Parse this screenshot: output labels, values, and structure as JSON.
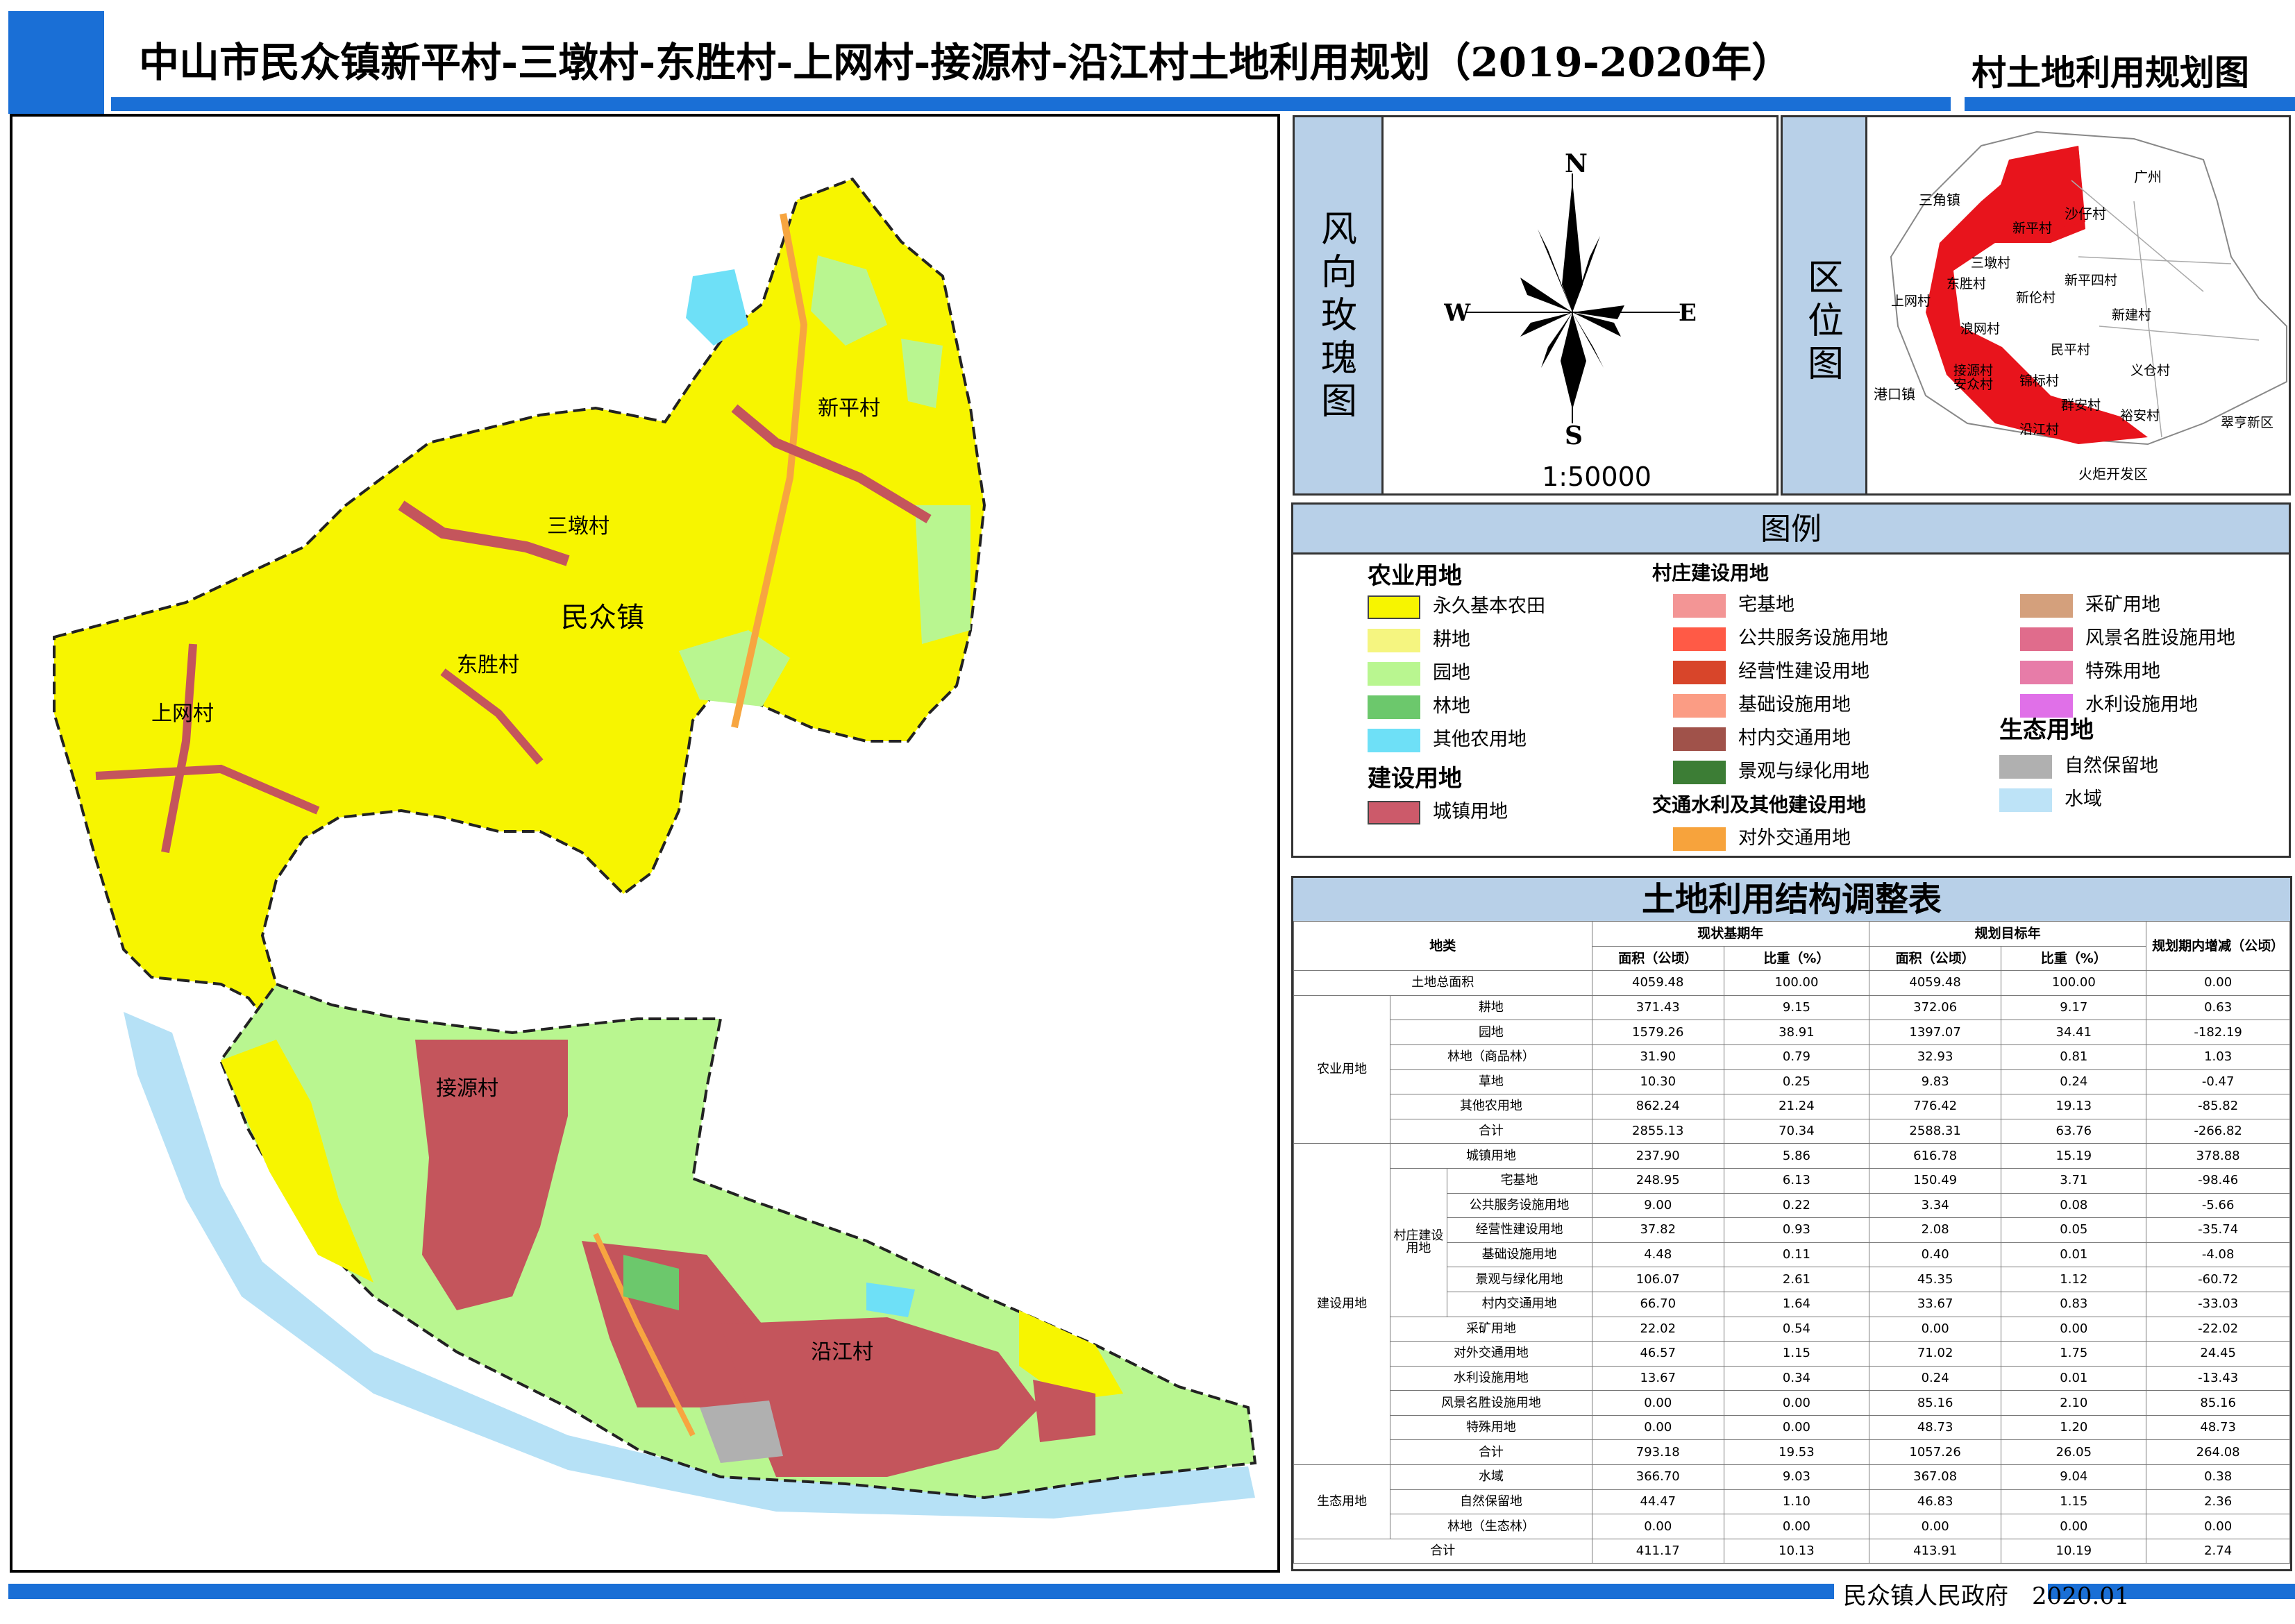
{
  "header": {
    "title": "中山市民众镇新平村-三墩村-东胜村-上网村-接源村-沿江村土地利用规划（2019-2020年）",
    "subtitle": "村土地利用规划图"
  },
  "footer": {
    "text": "民众镇人民政府　2020.01"
  },
  "map": {
    "labels": {
      "town": "民众镇",
      "xinping": "新平村",
      "sandun": "三墩村",
      "dongsheng": "东胜村",
      "shangwang": "上网村",
      "jieyuan": "接源村",
      "yanjiang": "沿江村"
    },
    "colors": {
      "permanent_farmland": "#f7f500",
      "garden": "#b9f690",
      "urban": "#c4555c",
      "forest": "#6cc86c",
      "other_agri": "#6ee0f7",
      "water": "#b6e1f6",
      "road": "#f7a540",
      "nature": "#b0b0b0",
      "scenic": "#e06c8c"
    }
  },
  "wind_rose": {
    "label": "风向玫瑰图",
    "north": "N",
    "south": "S",
    "east": "E",
    "west": "W",
    "scale": "1:50000"
  },
  "location": {
    "label": "区位图",
    "places": {
      "guangzhou": "广州",
      "sanjiao": "三角镇",
      "shazai": "沙仔村",
      "xinping": "新平村",
      "sandun": "三墩村",
      "dongsheng": "东胜村",
      "shangwang": "上网村",
      "xinping4": "新平四村",
      "xinlun": "新伦村",
      "xinjian": "新建村",
      "langwang": "浪网村",
      "minping": "民平村",
      "jieyuan": "接源村",
      "jinbiao": "锦标村",
      "yicang": "义仓村",
      "gangkou": "港口镇",
      "anzhong": "安众村",
      "qun_an": "群安村",
      "yu_an": "裕安村",
      "yanjiang": "沿江村",
      "cuiheng": "翠亨新区",
      "huoju": "火炬开发区"
    }
  },
  "legend": {
    "title": "图例",
    "groups": {
      "agri": "农业用地",
      "build": "建设用地",
      "village": "村庄建设用地",
      "transport": "交通水利及其他建设用地",
      "eco": "生态用地"
    },
    "items": [
      {
        "label": "永久基本农田",
        "color": "#f7f500",
        "border": true
      },
      {
        "label": "耕地",
        "color": "#f5f580",
        "border": false
      },
      {
        "label": "园地",
        "color": "#b9f690",
        "border": false
      },
      {
        "label": "林地",
        "color": "#6cc86c",
        "border": false
      },
      {
        "label": "其他农用地",
        "color": "#6ee0f7",
        "border": false
      },
      {
        "label": "城镇用地",
        "color": "#cc5a6a",
        "border": true
      },
      {
        "label": "宅基地",
        "color": "#f39595",
        "border": false
      },
      {
        "label": "公共服务设施用地",
        "color": "#ff5a46",
        "border": false
      },
      {
        "label": "经营性建设用地",
        "color": "#d8452a",
        "border": false
      },
      {
        "label": "基础设施用地",
        "color": "#fb9c84",
        "border": false
      },
      {
        "label": "村内交通用地",
        "color": "#a0524a",
        "border": false
      },
      {
        "label": "景观与绿化用地",
        "color": "#3c7d35",
        "border": false
      },
      {
        "label": "对外交通用地",
        "color": "#f7a33c",
        "border": false
      },
      {
        "label": "采矿用地",
        "color": "#d4a07c",
        "border": false
      },
      {
        "label": "风景名胜设施用地",
        "color": "#e06c8c",
        "border": false
      },
      {
        "label": "特殊用地",
        "color": "#e77ca8",
        "border": false
      },
      {
        "label": "水利设施用地",
        "color": "#e070e8",
        "border": false
      },
      {
        "label": "自然保留地",
        "color": "#b0b0b0",
        "border": false
      },
      {
        "label": "水域",
        "color": "#bde3f7",
        "border": false
      }
    ]
  },
  "table": {
    "title": "土地利用结构调整表",
    "headers": {
      "category": "地类",
      "base_year": "现状基期年",
      "target_year": "规划目标年",
      "change": "规划期内增减（公顷）",
      "area": "面积（公顷）",
      "ratio": "比重（%）"
    },
    "groups": {
      "agri": "农业用地",
      "build": "建设用地",
      "village": "村庄建设用地",
      "eco": "生态用地"
    },
    "rows": [
      {
        "name": "土地总面积",
        "v": [
          "4059.48",
          "100.00",
          "4059.48",
          "100.00",
          "0.00"
        ]
      },
      {
        "name": "耕地",
        "v": [
          "371.43",
          "9.15",
          "372.06",
          "9.17",
          "0.63"
        ]
      },
      {
        "name": "园地",
        "v": [
          "1579.26",
          "38.91",
          "1397.07",
          "34.41",
          "-182.19"
        ]
      },
      {
        "name": "林地（商品林）",
        "v": [
          "31.90",
          "0.79",
          "32.93",
          "0.81",
          "1.03"
        ]
      },
      {
        "name": "草地",
        "v": [
          "10.30",
          "0.25",
          "9.83",
          "0.24",
          "-0.47"
        ]
      },
      {
        "name": "其他农用地",
        "v": [
          "862.24",
          "21.24",
          "776.42",
          "19.13",
          "-85.82"
        ]
      },
      {
        "name": "合计",
        "v": [
          "2855.13",
          "70.34",
          "2588.31",
          "63.76",
          "-266.82"
        ]
      },
      {
        "name": "城镇用地",
        "v": [
          "237.90",
          "5.86",
          "616.78",
          "15.19",
          "378.88"
        ]
      },
      {
        "name": "宅基地",
        "v": [
          "248.95",
          "6.13",
          "150.49",
          "3.71",
          "-98.46"
        ]
      },
      {
        "name": "公共服务设施用地",
        "v": [
          "9.00",
          "0.22",
          "3.34",
          "0.08",
          "-5.66"
        ]
      },
      {
        "name": "经营性建设用地",
        "v": [
          "37.82",
          "0.93",
          "2.08",
          "0.05",
          "-35.74"
        ]
      },
      {
        "name": "基础设施用地",
        "v": [
          "4.48",
          "0.11",
          "0.40",
          "0.01",
          "-4.08"
        ]
      },
      {
        "name": "景观与绿化用地",
        "v": [
          "106.07",
          "2.61",
          "45.35",
          "1.12",
          "-60.72"
        ]
      },
      {
        "name": "村内交通用地",
        "v": [
          "66.70",
          "1.64",
          "33.67",
          "0.83",
          "-33.03"
        ]
      },
      {
        "name": "采矿用地",
        "v": [
          "22.02",
          "0.54",
          "0.00",
          "0.00",
          "-22.02"
        ]
      },
      {
        "name": "对外交通用地",
        "v": [
          "46.57",
          "1.15",
          "71.02",
          "1.75",
          "24.45"
        ]
      },
      {
        "name": "水利设施用地",
        "v": [
          "13.67",
          "0.34",
          "0.24",
          "0.01",
          "-13.43"
        ]
      },
      {
        "name": "风景名胜设施用地",
        "v": [
          "0.00",
          "0.00",
          "85.16",
          "2.10",
          "85.16"
        ]
      },
      {
        "name": "特殊用地",
        "v": [
          "0.00",
          "0.00",
          "48.73",
          "1.20",
          "48.73"
        ]
      },
      {
        "name": "合计",
        "v": [
          "793.18",
          "19.53",
          "1057.26",
          "26.05",
          "264.08"
        ]
      },
      {
        "name": "水域",
        "v": [
          "366.70",
          "9.03",
          "367.08",
          "9.04",
          "0.38"
        ]
      },
      {
        "name": "自然保留地",
        "v": [
          "44.47",
          "1.10",
          "46.83",
          "1.15",
          "2.36"
        ]
      },
      {
        "name": "林地（生态林）",
        "v": [
          "0.00",
          "0.00",
          "0.00",
          "0.00",
          "0.00"
        ]
      },
      {
        "name": "合计",
        "v": [
          "411.17",
          "10.13",
          "413.91",
          "10.19",
          "2.74"
        ]
      }
    ]
  }
}
